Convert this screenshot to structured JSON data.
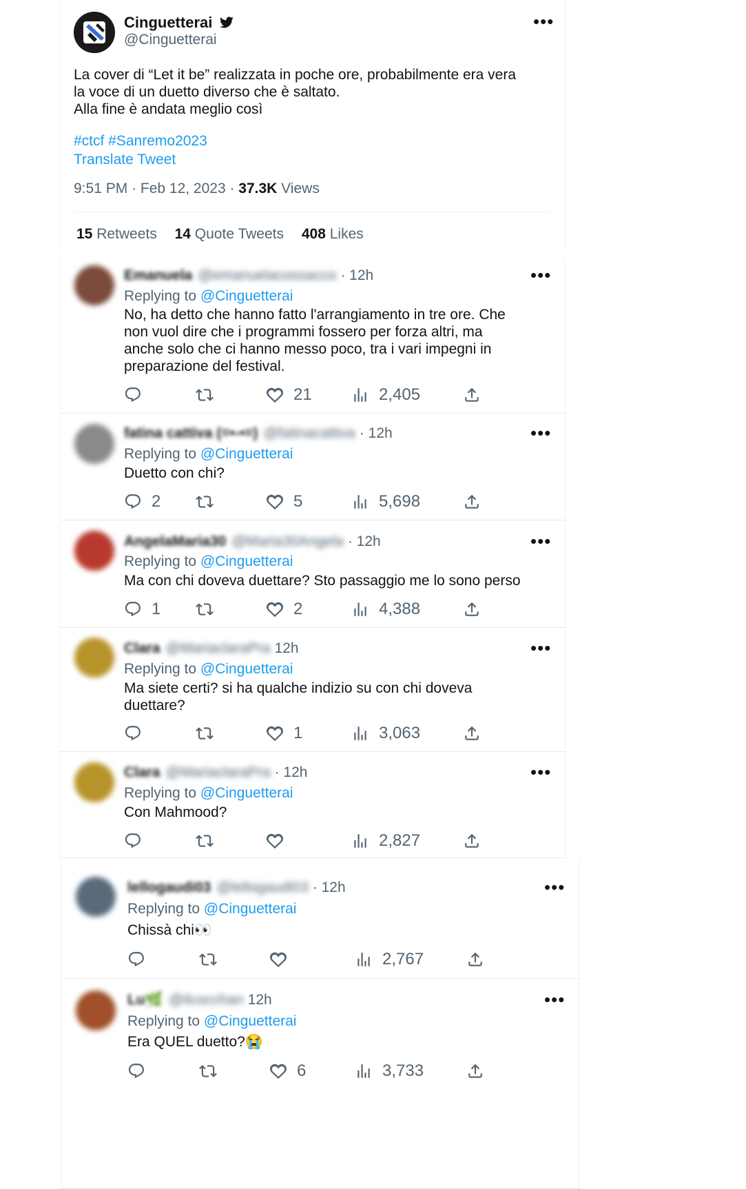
{
  "main_tweet": {
    "display_name": "Cinguetterai",
    "handle": "@Cinguetterai",
    "text_lines": [
      "La cover di “Let it be” realizzata in poche ore, probabilmente era vera",
      "la voce di un duetto diverso che è saltato.",
      "Alla fine è andata meglio così"
    ],
    "hashtags": "#ctcf #Sanremo2023",
    "translate": "Translate Tweet",
    "time": "9:51 PM · Feb 12, 2023 · ",
    "views_count": "37.3K",
    "views_label": " Views",
    "retweets_count": "15",
    "retweets_label": "Retweets",
    "quotes_count": "14",
    "quotes_label": "Quote Tweets",
    "likes_count": "408",
    "likes_label": "Likes"
  },
  "replying_prefix": "Replying to ",
  "replying_handle": "@Cinguetterai",
  "replies": [
    {
      "name": "Emanuela",
      "handle": "@emanuelacossacco",
      "time": "· 12h",
      "text_lines": [
        "No, ha detto che hanno fatto l'arrangiamento in tre ore. Che",
        "non vuol dire che i programmi fossero per forza altri, ma",
        "anche solo che ci hanno messo poco, tra i vari impegni in",
        "preparazione del festival."
      ],
      "replies": "",
      "retweets": "",
      "likes": "21",
      "views": "2,405",
      "avatar_color": "#7a4a3a"
    },
    {
      "name": "fatina cattiva (=•-•=)",
      "handle": "@fatinacattiva",
      "time": "· 12h",
      "text_lines": [
        "Duetto con chi?"
      ],
      "replies": "2",
      "retweets": "",
      "likes": "5",
      "views": "5,698",
      "avatar_color": "#8a8a8a"
    },
    {
      "name": "AngelaMaria30",
      "handle": "@Maria30Angela",
      "time": "· 12h",
      "text_lines": [
        "Ma con chi doveva duettare? Sto passaggio me lo sono perso"
      ],
      "replies": "1",
      "retweets": "",
      "likes": "2",
      "views": "4,388",
      "avatar_color": "#b83a2e"
    },
    {
      "name": "Clara",
      "handle": "@MariaclaraPra",
      "time": "12h",
      "text_lines": [
        "Ma siete certi? si ha qualche indizio su con chi doveva",
        "duettare?"
      ],
      "replies": "",
      "retweets": "",
      "likes": "1",
      "views": "3,063",
      "avatar_color": "#b8952a"
    },
    {
      "name": "Clara",
      "handle": "@MariaclaraPra",
      "time": "· 12h",
      "text_lines": [
        "Con Mahmood?"
      ],
      "replies": "",
      "retweets": "",
      "likes": "",
      "views": "2,827",
      "avatar_color": "#b8952a"
    },
    {
      "name": "lellogaudi03",
      "handle": "@lellogaudi03",
      "time": "· 12h",
      "text_lines": [
        "Chissà chi👀"
      ],
      "replies": "",
      "retweets": "",
      "likes": "",
      "views": "2,767",
      "avatar_color": "#5a6a7a"
    },
    {
      "name": "Lu🌿",
      "handle": "@ilcocchan",
      "time": "12h",
      "text_lines": [
        "Era QUEL duetto?😭"
      ],
      "replies": "",
      "retweets": "",
      "likes": "6",
      "views": "3,733",
      "avatar_color": "#a0502a"
    }
  ]
}
